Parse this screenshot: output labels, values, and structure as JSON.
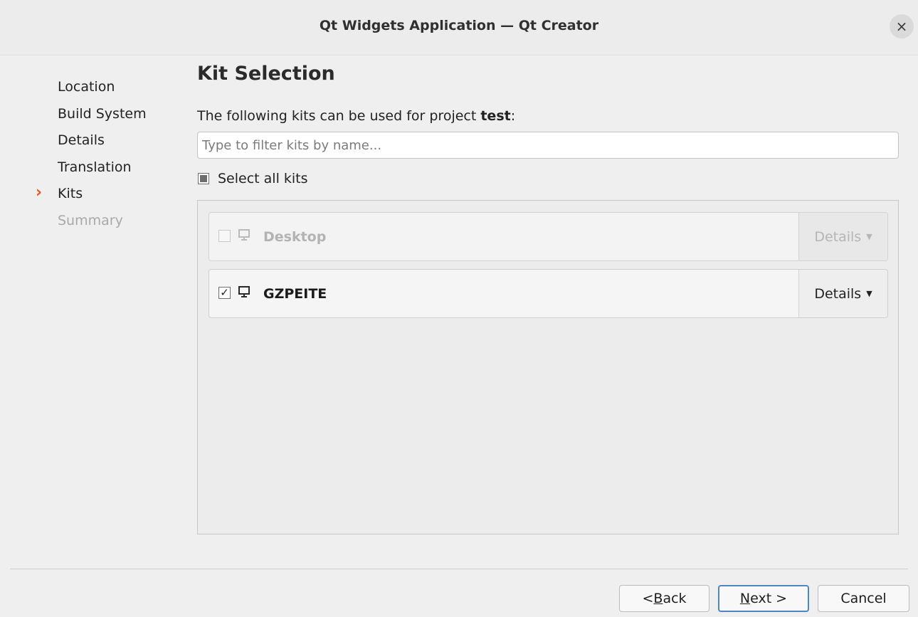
{
  "window": {
    "title": "Qt Widgets Application — Qt Creator",
    "close_symbol": "×"
  },
  "steps": [
    {
      "label": "Location",
      "state": "done"
    },
    {
      "label": "Build System",
      "state": "done"
    },
    {
      "label": "Details",
      "state": "done"
    },
    {
      "label": "Translation",
      "state": "done"
    },
    {
      "label": "Kits",
      "state": "current"
    },
    {
      "label": "Summary",
      "state": "pending"
    }
  ],
  "current_step_marker": "›",
  "page": {
    "title": "Kit Selection",
    "subtitle_prefix": "The following kits can be used for project ",
    "project_name": "test",
    "subtitle_suffix": ":",
    "filter_placeholder": "Type to filter kits by name...",
    "filter_value": "",
    "select_all_label": "Select all kits",
    "select_all_state": "partial"
  },
  "kits": [
    {
      "name": "Desktop",
      "checked": false,
      "enabled": false,
      "details_label": "Details",
      "icon": "monitor-icon"
    },
    {
      "name": "GZPEITE",
      "checked": true,
      "enabled": true,
      "details_label": "Details",
      "icon": "monitor-icon"
    }
  ],
  "buttons": {
    "back_prefix": "< ",
    "back_mnemonic": "B",
    "back_rest": "ack",
    "next_mnemonic": "N",
    "next_rest": "ext >",
    "cancel": "Cancel"
  },
  "colors": {
    "accent_arrow": "#e95420",
    "default_button_border": "#4f86c6"
  }
}
